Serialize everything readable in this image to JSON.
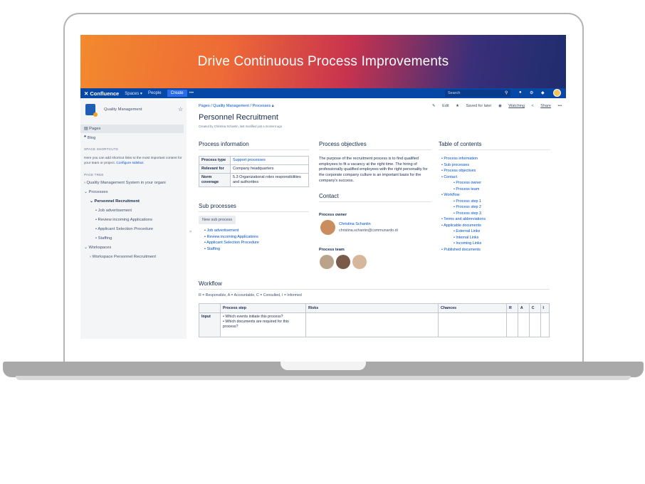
{
  "banner": {
    "title": "Drive Continuous Process Improvements"
  },
  "topnav": {
    "logo": "Confluence",
    "spaces": "Spaces ▾",
    "people": "People",
    "create": "Create",
    "more": "•••",
    "search_placeholder": "Search"
  },
  "sidebar": {
    "space_name": "Quality Management",
    "items": [
      {
        "label": "Pages"
      },
      {
        "label": "Blog"
      }
    ],
    "shortcuts_heading": "SPACE SHORTCUTS",
    "shortcuts_text": "Here you can add shortcut links to the most important content for your team or project.",
    "configure_link": "Configure sidebar.",
    "tree_heading": "PAGE TREE",
    "tree": [
      {
        "label": "Quality Management System in your organi",
        "indent": 0,
        "prefix": "›"
      },
      {
        "label": "Processes",
        "indent": 0,
        "prefix": "⌄"
      },
      {
        "label": "Personnel Recruitment",
        "indent": 1,
        "prefix": "⌄",
        "bold": true
      },
      {
        "label": "Job advertisement",
        "indent": 2,
        "prefix": "•"
      },
      {
        "label": "Review incoming Applications",
        "indent": 2,
        "prefix": "•"
      },
      {
        "label": "Applicant Selection Procedure",
        "indent": 2,
        "prefix": "•"
      },
      {
        "label": "Staffing",
        "indent": 2,
        "prefix": "•"
      },
      {
        "label": "Workspaces",
        "indent": 0,
        "prefix": "⌄"
      },
      {
        "label": "Workspace Personnel Recruitment",
        "indent": 1,
        "prefix": "›"
      }
    ]
  },
  "page": {
    "breadcrumbs": "Pages / Quality Management / Processes",
    "actions": {
      "edit": "Edit",
      "saved": "Saved for later",
      "watching": "Watching",
      "share": "Share",
      "more": "•••"
    },
    "title": "Personnel Recruitment",
    "byline": "Created by Christina Schantin, last modified just a moment ago",
    "process_info": {
      "heading": "Process information",
      "rows": [
        {
          "key": "Process type",
          "value": "Support processes"
        },
        {
          "key": "Relevant for",
          "value": "Company headquarters"
        },
        {
          "key": "Norm coverage",
          "value": "5.3 Organizational roles responsibilities and authorities"
        }
      ]
    },
    "sub_processes": {
      "heading": "Sub processes",
      "button": "New sub process",
      "items": [
        "Job advertisement",
        "Review incoming Applications",
        "Applicant Selection Procedure",
        "Staffing"
      ]
    },
    "objectives": {
      "heading": "Process objectives",
      "text": "The purpose of the recruitment process is to find qualified employees to fit a vacancy at the right time. The hiring of professionally qualified employees with the right personality for the corporate company culture is an important basis for the company's success."
    },
    "contact": {
      "heading": "Contact",
      "owner_label": "Process owner",
      "owner_name": "Christina Schantin",
      "owner_email": "christina.schantin@communardo.di",
      "team_label": "Process team"
    },
    "toc": {
      "heading": "Table of contents",
      "items": [
        {
          "label": "Process information",
          "level": 0
        },
        {
          "label": "Sub processes",
          "level": 0
        },
        {
          "label": "Process objectives",
          "level": 0
        },
        {
          "label": "Contact",
          "level": 0
        },
        {
          "label": "Process owner",
          "level": 1
        },
        {
          "label": "Process team",
          "level": 1
        },
        {
          "label": "Workflow",
          "level": 0
        },
        {
          "label": "Process step 1",
          "level": 1
        },
        {
          "label": "Process step 2",
          "level": 1
        },
        {
          "label": "Process step 3",
          "level": 1
        },
        {
          "label": "Terms and abbreviations",
          "level": 0
        },
        {
          "label": "Applicable documents",
          "level": 0
        },
        {
          "label": "External Links",
          "level": 1
        },
        {
          "label": "Internal Links",
          "level": 1
        },
        {
          "label": "Incoming Links",
          "level": 1
        },
        {
          "label": "Published documents",
          "level": 0
        }
      ]
    },
    "workflow": {
      "heading": "Workflow",
      "legend": "R = Responsible, A = Accountable, C = Consulted, I = Informed",
      "columns": [
        "",
        "Process step",
        "Risks",
        "Chances",
        "R",
        "A",
        "C",
        "I"
      ],
      "rows": [
        {
          "label": "Input",
          "steps": [
            "Which events initiate this process?",
            "Which documents are required for this process?"
          ]
        }
      ]
    }
  }
}
